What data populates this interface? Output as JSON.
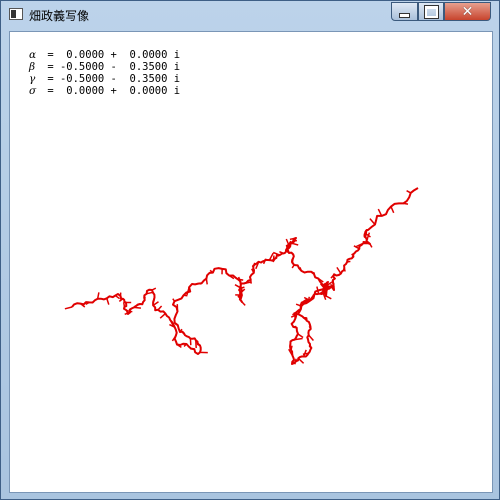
{
  "window": {
    "title": "畑政義写像",
    "icon": "window-app-icon",
    "controls": {
      "minimize": "minimize-icon",
      "maximize": "maximize-icon",
      "close": "close-icon"
    }
  },
  "params": [
    {
      "symbol": "α",
      "text": " =  0.0000 +  0.0000 i"
    },
    {
      "symbol": "β",
      "text": " = -0.5000 -  0.3500 i"
    },
    {
      "symbol": "γ",
      "text": " = -0.5000 -  0.3500 i"
    },
    {
      "symbol": "σ",
      "text": " =  0.0000 +  0.0000 i"
    }
  ],
  "fractal": {
    "color": "#e00000"
  }
}
